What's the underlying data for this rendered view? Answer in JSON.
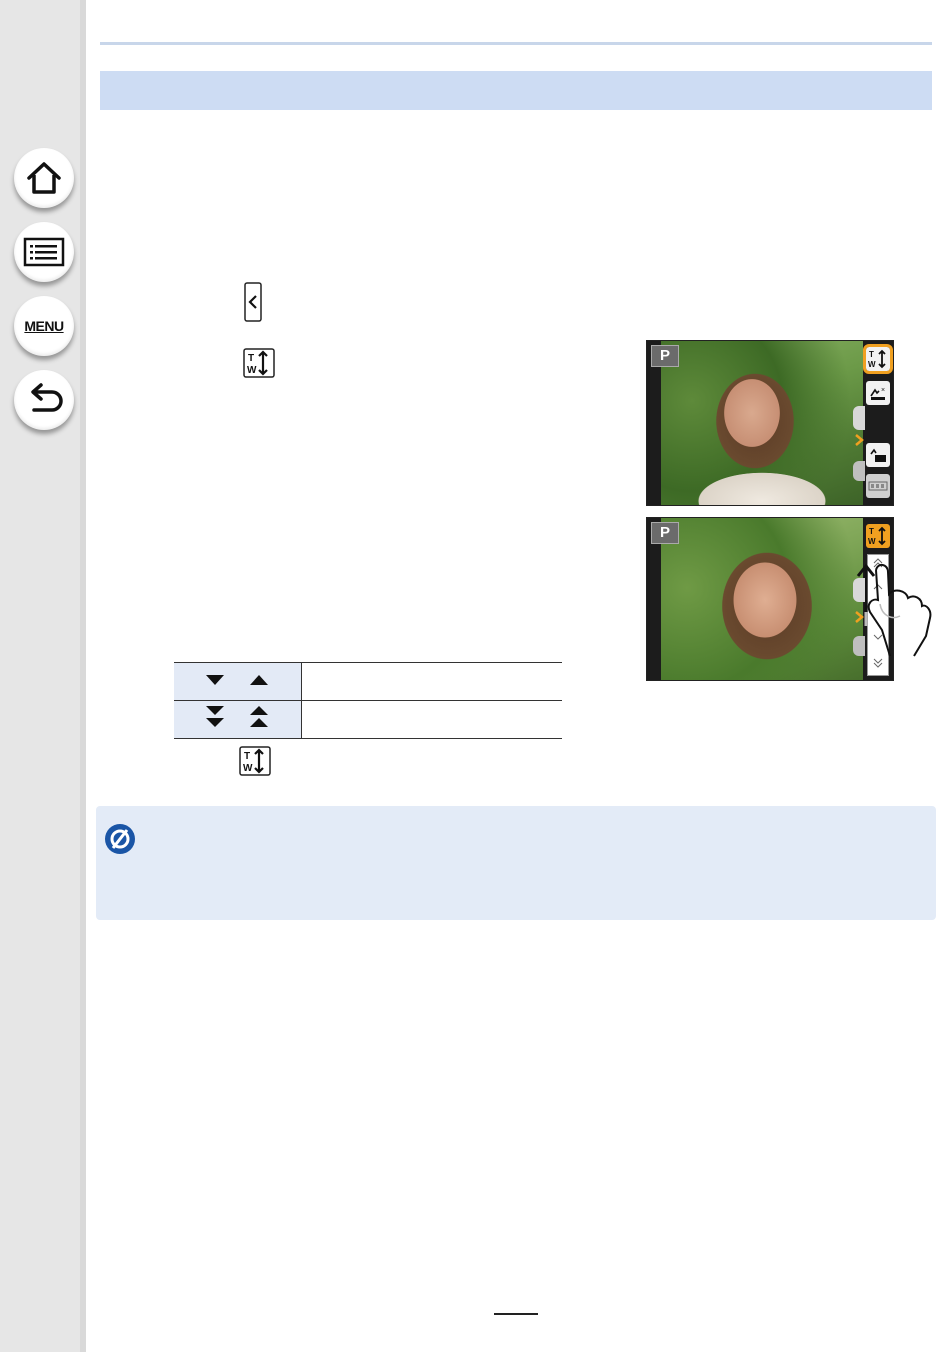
{
  "sidebar": {
    "items": [
      {
        "name": "home",
        "icon": "home-icon"
      },
      {
        "name": "contents",
        "icon": "list-icon"
      },
      {
        "name": "menu",
        "label": "MENU",
        "icon": "menu-icon"
      },
      {
        "name": "back",
        "icon": "back-arrow-icon"
      }
    ]
  },
  "inline_icons": [
    "tab-open-icon",
    "touch-zoom-icon",
    "touch-zoom-icon"
  ],
  "screens": [
    {
      "mode": "P",
      "selected_button": "touch-zoom-button"
    },
    {
      "mode": "P",
      "selected_button": "touch-zoom-button"
    }
  ],
  "zoom_table": {
    "rows": [
      {
        "symbols": "slow-zoom-arrows-icon"
      },
      {
        "symbols": "fast-zoom-arrows-icon"
      }
    ]
  },
  "note": {
    "icon": "not-available-icon"
  },
  "colors": {
    "header_band": "#cddcf3",
    "note_box": "#e3ebf7",
    "sidebar": "#e6e6e6",
    "highlight": "#f0a020",
    "accent_blue": "#1a55a6"
  }
}
